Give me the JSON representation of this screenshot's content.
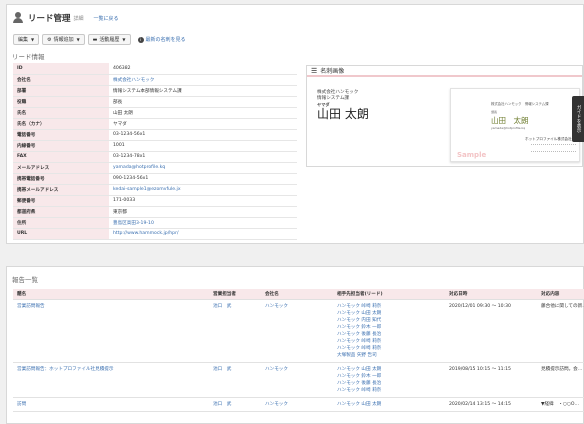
{
  "header": {
    "title": "リード管理",
    "subtitle": "詳細",
    "back_link": "一覧に戻る"
  },
  "toolbar": {
    "edit_label": "編集",
    "info_add_label": "情報追加",
    "activity_label": "活動履歴",
    "latest_card_label": "最新の名刺を見る"
  },
  "lead_section_title": "リード情報",
  "lead_fields": [
    {
      "label": "ID",
      "value": "406382",
      "link": false
    },
    {
      "label": "会社名",
      "value": "株式会社ハンモック",
      "link": true
    },
    {
      "label": "部署",
      "value": "情報システム本部情報システム課",
      "link": false
    },
    {
      "label": "役職",
      "value": "部長",
      "link": false
    },
    {
      "label": "氏名",
      "value": "山田 太朗",
      "link": false
    },
    {
      "label": "氏名（カナ）",
      "value": "ヤマダ",
      "link": false
    },
    {
      "label": "電話番号",
      "value": "03-1234-56x1",
      "link": false
    },
    {
      "label": "内線番号",
      "value": "1001",
      "link": false
    },
    {
      "label": "FAX",
      "value": "03-1234-78x1",
      "link": false
    },
    {
      "label": "メールアドレス",
      "value": "yamada@hotprofile.kq",
      "link": true
    },
    {
      "label": "携帯電話番号",
      "value": "090-1234-56x1",
      "link": false
    },
    {
      "label": "携帯メールアドレス",
      "value": "kedai-sample1@ezomvfule.jx",
      "link": true
    },
    {
      "label": "郵便番号",
      "value": "171-0033",
      "link": false
    },
    {
      "label": "都道府県",
      "value": "東京都",
      "link": false
    },
    {
      "label": "住所",
      "value": "豊島区高田3-19-10",
      "link": true
    },
    {
      "label": "URL",
      "value": "http://www.hammock.jp/hpr/",
      "link": true
    }
  ],
  "card": {
    "title": "名刺画像",
    "company": "株式会社ハンモック",
    "department": "情報システム課",
    "kana": "ヤマダ",
    "name": "山田 太朗",
    "image_company": "株式会社ハンモック　情報システム課",
    "image_role": "課長",
    "image_name": "山田　太朗",
    "image_email": "yamada@hotprofile.kq",
    "image_corp": "ホットプロファイル株式会社",
    "image_sample": "Sample"
  },
  "guide_tab_label": "ガイドを表示",
  "reports": {
    "section_title": "報告一覧",
    "columns": [
      "題名",
      "営業担当者",
      "会社名",
      "相手先担当者(リード)",
      "対応日時",
      "対応内容"
    ],
    "rows": [
      {
        "title": "営業訪問報告",
        "rep": "池口　武",
        "company": "ハンモック",
        "contacts": [
          "ハンモック 峠崎 莉奈",
          "ハンモック 山田 太朗",
          "ハンモック 内田 知代",
          "ハンモック 鈴木 一郎",
          "ハンモック 後藤 長治",
          "ハンモック 峠崎 莉奈",
          "ハンモック 峠崎 莉奈",
          "大塚製品 矢野 告司"
        ],
        "datetime": "2020/12/01 09:30 ～ 10:30",
        "content": "藤合他に関しての新…"
      },
      {
        "title": "営業訪問報告：ホットプロファイル社見積提示",
        "rep": "池口　武",
        "company": "ハンモック",
        "contacts": [
          "ハンモック 山田 太朗",
          "ハンモック 鈴木 一郎",
          "ハンモック 後藤 長治",
          "ハンモック 峠崎 莉奈"
        ],
        "datetime": "2019/08/15 10:15 ～ 11:15",
        "content": "見積提示訪問。会…"
      },
      {
        "title": "訪問",
        "rep": "池口　武",
        "company": "ハンモック",
        "contacts": [
          "ハンモック 山田 太朗"
        ],
        "datetime": "2020/02/14 13:15 ～ 14:15",
        "content": "▼経緯　・○○O…"
      }
    ]
  }
}
